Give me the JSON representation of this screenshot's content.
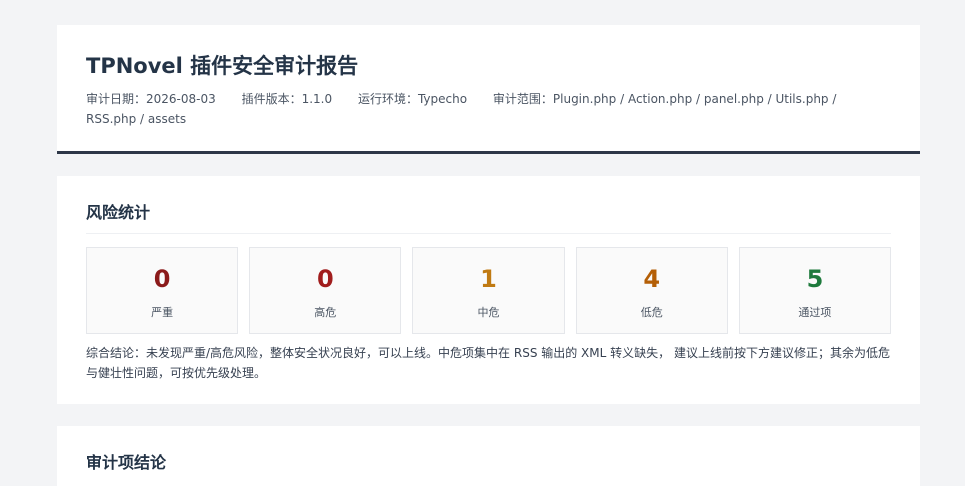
{
  "header": {
    "title": "TPNovel 插件安全审计报告",
    "meta": {
      "date": "审计日期：2026-08-03",
      "version": "插件版本：1.1.0",
      "env": "运行环境：Typecho",
      "scope": "审计范围：Plugin.php / Action.php / panel.php / Utils.php / RSS.php / assets"
    }
  },
  "risk": {
    "title": "风险统计",
    "stats": [
      {
        "value": "0",
        "label": "严重",
        "color": "#8b1a1a"
      },
      {
        "value": "0",
        "label": "高危",
        "color": "#a11d1d"
      },
      {
        "value": "1",
        "label": "中危",
        "color": "#c07a12"
      },
      {
        "value": "4",
        "label": "低危",
        "color": "#b45f06"
      },
      {
        "value": "5",
        "label": "通过项",
        "color": "#1e7a3c"
      }
    ],
    "summary": "综合结论：未发现严重/高危风险，整体安全状况良好，可以上线。中危项集中在 RSS 输出的 XML 转义缺失， 建议上线前按下方建议修正；其余为低危与健壮性问题，可按优先级处理。"
  },
  "audit": {
    "title": "审计项结论"
  }
}
